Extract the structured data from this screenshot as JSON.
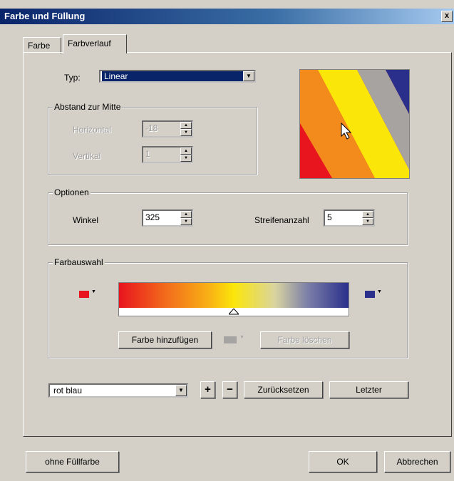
{
  "window": {
    "title": "Farbe und Füllung",
    "close_label": "x"
  },
  "tabs": [
    {
      "label": "Farbe"
    },
    {
      "label": "Farbverlauf"
    }
  ],
  "type": {
    "label": "Typ:",
    "value": "Linear"
  },
  "distance": {
    "title": "Abstand zur Mitte",
    "horizontal_label": "Horizontal",
    "horizontal_value": "-18",
    "vertical_label": "Vertikal",
    "vertical_value": "1"
  },
  "options": {
    "title": "Optionen",
    "angle_label": "Winkel",
    "angle_value": "325",
    "stripes_label": "Streifenanzahl",
    "stripes_value": "5"
  },
  "colorpick": {
    "title": "Farbauswahl",
    "start_color": "#e8141e",
    "end_color": "#2a2f8c",
    "add_label": "Farbe hinzufügen",
    "delete_label": "Farbe löschen",
    "mid_color": "#a0a0a0"
  },
  "preset": {
    "value": "rot blau",
    "plus_label": "+",
    "minus_label": "−",
    "reset_label": "Zurücksetzen",
    "last_label": "Letzter"
  },
  "preview_colors": [
    "#e8141e",
    "#f28a1c",
    "#fbe60a",
    "#a6a3a0",
    "#2a2f8c"
  ],
  "footer": {
    "nofill_label": "ohne Füllfarbe",
    "ok_label": "OK",
    "cancel_label": "Abbrechen"
  }
}
